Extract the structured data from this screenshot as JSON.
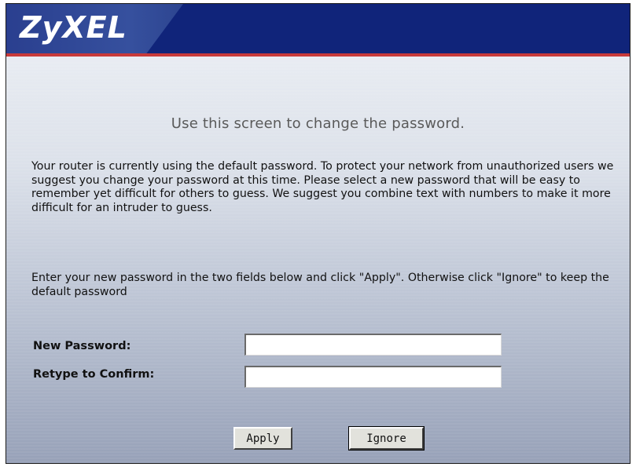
{
  "header": {
    "logo_text": "ZyXEL"
  },
  "main": {
    "title": "Use this screen to change the password.",
    "paragraph1": "Your router is currently using the default password. To protect your network from unauthorized users we suggest you change your password at this time. Please select a new password that will be easy to remember yet difficult for others to guess. We suggest you combine text with numbers to make it more difficult for an intruder to guess.",
    "paragraph2": "Enter your new password in the two fields below and click \"Apply\". Otherwise click \"Ignore\" to keep the default password"
  },
  "form": {
    "new_password_label": "New Password:",
    "new_password_value": "",
    "confirm_label": "Retype to Confirm:",
    "confirm_value": ""
  },
  "buttons": {
    "apply_label": "Apply",
    "ignore_label": "Ignore"
  },
  "colors": {
    "header_blue": "#10247a",
    "header_accent_red": "#c83a3a",
    "title_gray": "#5a5a5a"
  }
}
